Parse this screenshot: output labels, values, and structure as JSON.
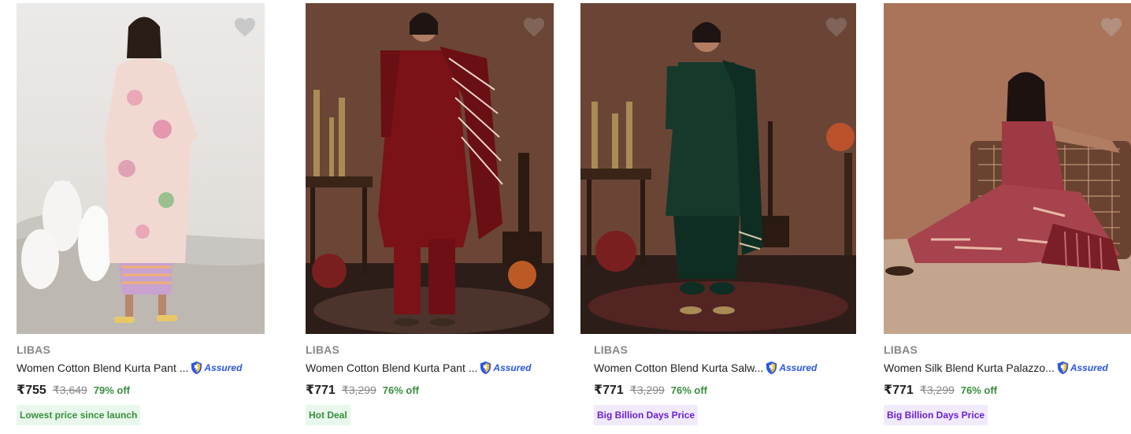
{
  "products": [
    {
      "brand": "LIBAS",
      "title": "Women Cotton Blend Kurta Pant ...",
      "assured_label": "Assured",
      "price": "₹755",
      "mrp": "₹3,649",
      "discount": "79% off",
      "tag": "Lowest price since launch",
      "tag_style": "green",
      "image_alt": "Model wearing pastel floral cotton kurta with striped pants"
    },
    {
      "brand": "LIBAS",
      "title": "Women Cotton Blend Kurta Pant ...",
      "assured_label": "Assured",
      "price": "₹771",
      "mrp": "₹3,299",
      "discount": "76% off",
      "tag": "Hot Deal",
      "tag_style": "green",
      "image_alt": "Model wearing maroon kurta pant set with dupatta"
    },
    {
      "brand": "LIBAS",
      "title": "Women Cotton Blend Kurta Salw...",
      "assured_label": "Assured",
      "price": "₹771",
      "mrp": "₹3,299",
      "discount": "76% off",
      "tag": "Big Billion Days Price",
      "tag_style": "purple",
      "image_alt": "Model wearing dark green kurta salwar set with dupatta"
    },
    {
      "brand": "LIBAS",
      "title": "Women Silk Blend Kurta Palazzo...",
      "assured_label": "Assured",
      "price": "₹771",
      "mrp": "₹3,299",
      "discount": "76% off",
      "tag": "Big Billion Days Price",
      "tag_style": "purple",
      "image_alt": "Model wearing printed maroon silk blend kurta palazzo set"
    }
  ],
  "colors": {
    "assured_blue": "#2a55e5",
    "discount_green": "#388e3c",
    "tag_green_bg": "#e8f8ec",
    "tag_purple_bg": "#f1eafd",
    "tag_purple_text": "#6a1fd8"
  }
}
